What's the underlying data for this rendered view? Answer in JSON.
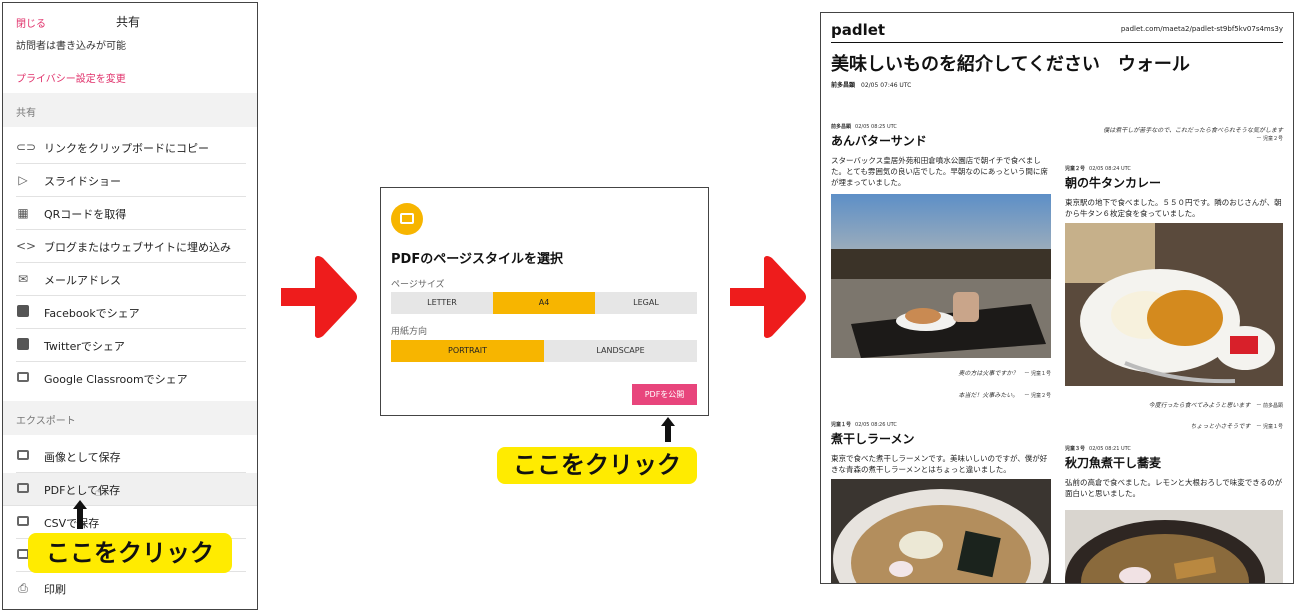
{
  "share_panel": {
    "close_label": "閉じる",
    "title": "共有",
    "visitor_text": "訪問者は書き込みが可能",
    "privacy_link": "プライバシー設定を変更",
    "share_section": "共有",
    "share_items": [
      {
        "icon": "link-icon",
        "label": "リンクをクリップボードにコピー"
      },
      {
        "icon": "play-icon",
        "label": "スライドショー"
      },
      {
        "icon": "qr-code-icon",
        "label": "QRコードを取得"
      },
      {
        "icon": "code-icon",
        "label": "ブログまたはウェブサイトに埋め込み"
      },
      {
        "icon": "mail-icon",
        "label": "メールアドレス"
      },
      {
        "icon": "facebook-icon",
        "label": "Facebookでシェア"
      },
      {
        "icon": "twitter-icon",
        "label": "Twitterでシェア"
      },
      {
        "icon": "google-classroom-icon",
        "label": "Google Classroomでシェア"
      }
    ],
    "export_section": "エクスポート",
    "export_items": [
      {
        "icon": "image-export-icon",
        "label": "画像として保存"
      },
      {
        "icon": "pdf-export-icon",
        "label": "PDFとして保存"
      },
      {
        "icon": "csv-export-icon",
        "label": "CSVで保存"
      },
      {
        "icon": "excel-export-icon",
        "label": ""
      },
      {
        "icon": "print-icon",
        "label": "印刷"
      }
    ]
  },
  "pdf_dialog": {
    "title": "PDFのページスタイルを選択",
    "page_size_label": "ページサイズ",
    "page_sizes": [
      "LETTER",
      "A4",
      "LEGAL"
    ],
    "selected_page_size": "A4",
    "orientation_label": "用紙方向",
    "orientations": [
      "PORTRAIT",
      "LANDSCAPE"
    ],
    "selected_orientation": "PORTRAIT",
    "publish_button": "PDFを公開"
  },
  "callouts": {
    "left": "ここをクリック",
    "middle": "ここをクリック"
  },
  "pdf_preview": {
    "brand": "padlet",
    "url": "padlet.com/maeta2/padlet-st9bf5kv07s4ms3y",
    "wall_title": "美味しいものを紹介してください　ウォール",
    "author": "前多昌顕",
    "timestamp": "02/05 07:46 UTC",
    "posts": [
      {
        "author": "前多昌顕",
        "time": "02/05 08:25 UTC",
        "title": "あんバターサンド",
        "body": "スターバックス皇居外苑和田倉噴水公園店で朝イチで食べました。とても雰囲気の良い店でした。早朝なのにあっという間に席が埋まっていました。",
        "comments": [
          {
            "text": "奥の方は火事ですか？",
            "by": "ー 児童１号"
          },
          {
            "text": "本当だ！火事みたい。",
            "by": "ー 児童２号"
          }
        ]
      },
      {
        "author": "",
        "time": "",
        "title": "",
        "body": "",
        "comments": [
          {
            "text": "僕は煮干しが苦手なので、これだったら食べられそうな気がします",
            "by": "ー 児童２号"
          }
        ]
      },
      {
        "author": "児童２号",
        "time": "02/05 08:24 UTC",
        "title": "朝の牛タンカレー",
        "body": "東京駅の地下で食べました。５５０円です。隣のおじさんが、朝から牛タン６枚定食を食っていました。",
        "comments": [
          {
            "text": "今度行ったら食べてみようと思います",
            "by": "ー 前多昌顕"
          },
          {
            "text": "ちょっと小さそうです",
            "by": "ー 児童１号"
          }
        ]
      },
      {
        "author": "児童１号",
        "time": "02/05 08:26 UTC",
        "title": "煮干しラーメン",
        "body": "東京で食べた煮干しラーメンです。美味いしいのですが、僕が好きな青森の煮干しラーメンとはちょっと違いました。",
        "comments": []
      },
      {
        "author": "児童３号",
        "time": "02/05 08:21 UTC",
        "title": "秋刀魚煮干し蕎麦",
        "body": "弘前の高倉で食べました。レモンと大根おろしで味変できるのが面白いと思いました。",
        "comments": []
      }
    ]
  },
  "colors": {
    "accent_pink": "#e0306a",
    "publish_pink": "#e8457c",
    "selected_yellow": "#f7b500",
    "callout_yellow": "#ffeb00",
    "arrow_red": "#ee1c1c"
  }
}
